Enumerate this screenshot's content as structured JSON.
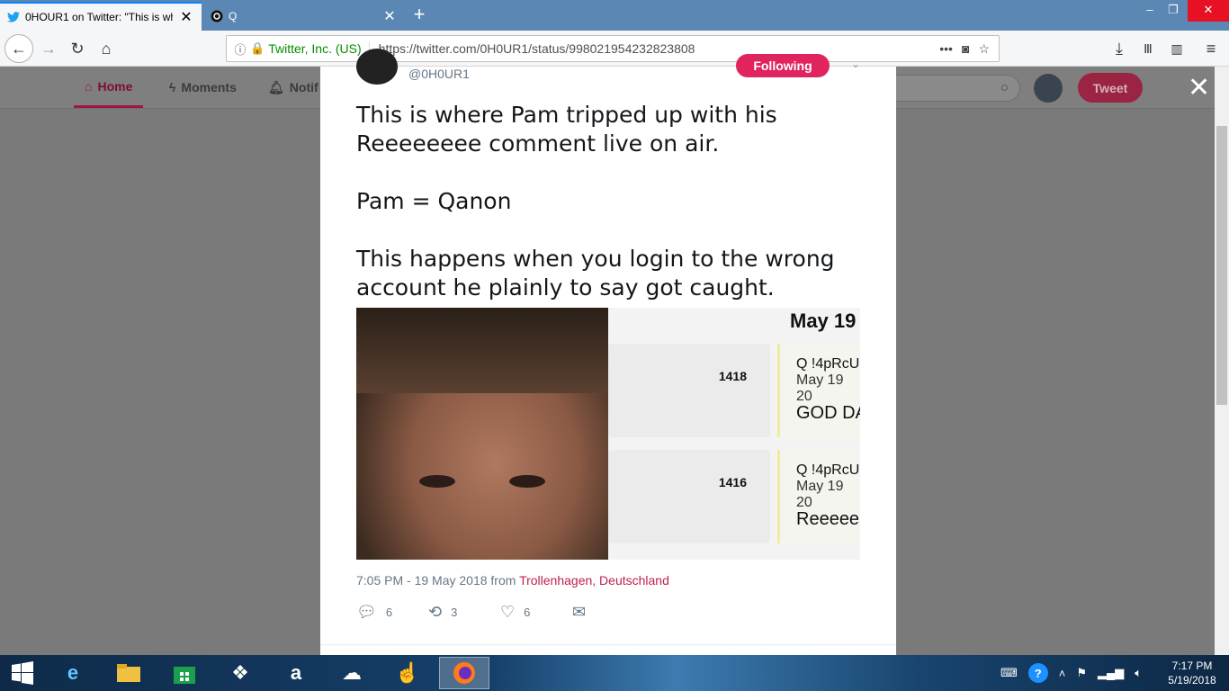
{
  "browser": {
    "tabs": [
      {
        "label": "0HOUR1 on Twitter: \"This is wh",
        "active": true
      },
      {
        "label": "Q",
        "active": false
      }
    ],
    "identity": "Twitter, Inc. (US)",
    "url": "https://twitter.com/0H0UR1/status/998021954232823808"
  },
  "twitter_header": {
    "nav": [
      {
        "label": "Home"
      },
      {
        "label": "Moments"
      },
      {
        "label": "Notif"
      }
    ],
    "search_placeholder": "r",
    "tweet_button": "Tweet"
  },
  "tweet": {
    "handle": "@0H0UR1",
    "follow_label": "Following",
    "text": "This is where Pam tripped up with his\nReeeeeeee comment live on air.\n\nPam = Qanon\n\nThis happens when you login to the wrong\naccount he plainly to say got caught.",
    "media": {
      "date_header": "May 19",
      "posts": [
        {
          "number": "1418",
          "author": "Q !4pRcU",
          "date": "May 19 20",
          "body": "GOD DA"
        },
        {
          "number": "1416",
          "author": "Q !4pRcU",
          "date": "May 19 20",
          "body": "Reeeee"
        }
      ]
    },
    "timestamp": "7:05 PM - 19 May 2018 from ",
    "location": "Trollenhagen, Deutschland",
    "replies": "6",
    "retweets": "3",
    "likes": "6"
  },
  "taskbar": {
    "time": "7:17 PM",
    "date": "5/19/2018"
  }
}
